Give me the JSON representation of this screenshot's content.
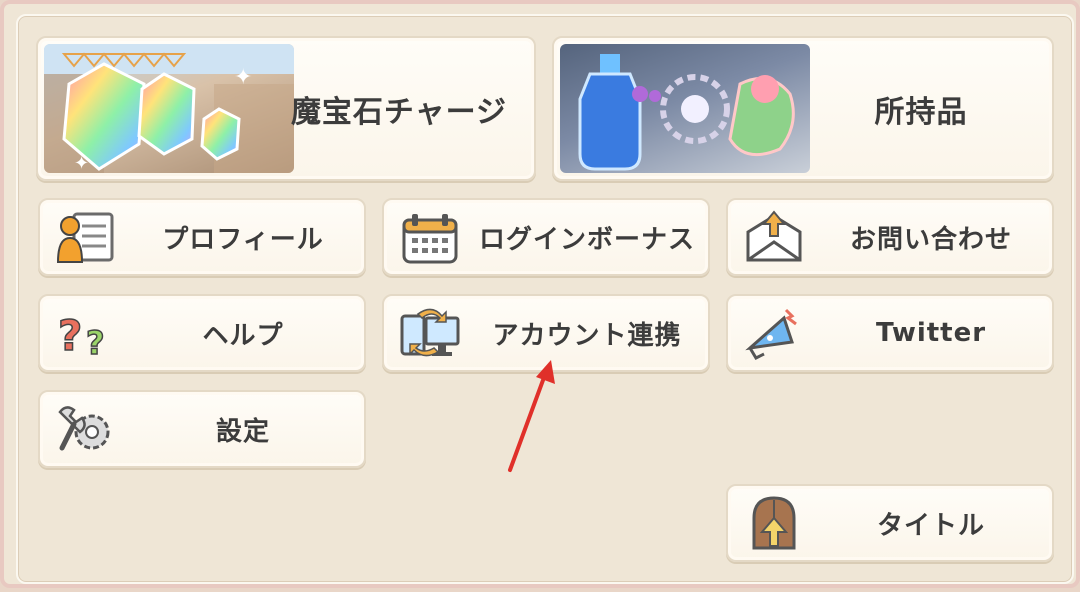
{
  "menu": {
    "jewel_charge": {
      "label": "魔宝石チャージ",
      "icon": "rainbow-gem-icon"
    },
    "inventory": {
      "label": "所持品",
      "icon": "potion-items-icon"
    },
    "profile": {
      "label": "プロフィール",
      "icon": "profile-card-icon"
    },
    "login_bonus": {
      "label": "ログインボーナス",
      "icon": "calendar-icon"
    },
    "contact": {
      "label": "お問い合わせ",
      "icon": "mail-icon"
    },
    "help": {
      "label": "ヘルプ",
      "icon": "question-icon"
    },
    "account_link": {
      "label": "アカウント連携",
      "icon": "device-sync-icon"
    },
    "twitter": {
      "label": "Twitter",
      "icon": "megaphone-icon"
    },
    "settings": {
      "label": "設定",
      "icon": "gear-wrench-icon"
    },
    "title": {
      "label": "タイトル",
      "icon": "door-icon"
    }
  },
  "colors": {
    "background": "#efe6d6",
    "button_bg": "#fffdf8",
    "button_border": "#e4d9c6",
    "text": "#3c3c3c",
    "annotation_arrow": "#e0302a"
  }
}
